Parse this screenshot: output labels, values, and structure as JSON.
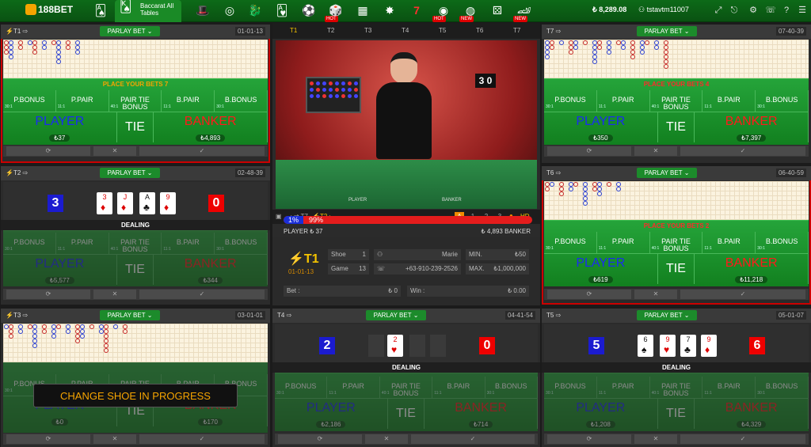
{
  "brand": {
    "logo": "188BET"
  },
  "nav": {
    "category": "Baccarat All Tables",
    "hot": "HOT",
    "new": "NEW"
  },
  "account": {
    "balance": "8,289.08",
    "user": "tstavtm11007"
  },
  "common": {
    "parlay": "PARLAY BET",
    "place": "PLACE YOUR BETS",
    "dealing": "DEALING",
    "side": {
      "pbonus": "P.BONUS",
      "ppair": "P.PAIR",
      "tiebonus": "PAIR TIE BONUS",
      "bpair": "B.PAIR",
      "bbonus": "B.BONUS"
    },
    "player": "PLAYER",
    "tie": "TIE",
    "banker": "BANKER",
    "odds": {
      "bonus": "30:1",
      "pair": "11:1",
      "tb": "40:1",
      "one": "1:1",
      "eight": "8:1",
      "banker": "0.95:1"
    }
  },
  "tables": {
    "t1": {
      "name": "T1",
      "code": "01-01-13",
      "countdown": "7",
      "player": "37",
      "banker": "4,893"
    },
    "t2": {
      "name": "T2",
      "code": "02-48-39",
      "pscore": "3",
      "bscore": "0",
      "player": "5,577",
      "banker": "344",
      "cards": [
        "3",
        "J",
        "A",
        "9"
      ]
    },
    "t3": {
      "name": "T3",
      "code": "03-01-01",
      "player": "0",
      "banker": "170",
      "message": "CHANGE SHOE IN PROGRESS"
    },
    "t4": {
      "name": "T4",
      "code": "04-41-54",
      "pscore": "2",
      "bscore": "0",
      "player": "2,186",
      "banker": "714",
      "cards": [
        "2"
      ]
    },
    "t5": {
      "name": "T5",
      "code": "05-01-07",
      "pscore": "5",
      "bscore": "6",
      "player": "1,208",
      "banker": "4,329",
      "cards": [
        "6",
        "9",
        "7",
        "9"
      ]
    },
    "t6": {
      "name": "T6",
      "code": "06-40-59",
      "countdown": "2",
      "player": "619",
      "banker": "11,218"
    },
    "t7": {
      "name": "T7",
      "code": "07-40-39",
      "countdown": "4",
      "player": "350",
      "banker": "7,397"
    }
  },
  "live": {
    "tabs": [
      "T1",
      "T2",
      "T3",
      "T4",
      "T5",
      "T6",
      "T7"
    ],
    "video_overlay": {
      "scoreboard": "3 0",
      "player_label": "PLAYER",
      "banker_label": "BANKER"
    },
    "prev": "T7",
    "next": "T2",
    "quality": [
      "A",
      "1",
      "2",
      "3"
    ],
    "hd": "HD",
    "player_pct": 1,
    "player_pct_label": "1%",
    "banker_pct_label": "99%",
    "player_total": "PLAYER  ₺ 37",
    "banker_total": "₺ 4,893 BANKER",
    "table": "T1",
    "code": "01-01-13",
    "shoe_label": "Shoe",
    "shoe": "1",
    "game_label": "Game",
    "game": "13",
    "dealer": "Marie",
    "phone": "+63-910-239-2526",
    "min_label": "MIN.",
    "min": "₺50",
    "max_label": "MAX.",
    "max": "₺1,000,000",
    "bet_label": "Bet :",
    "bet": "₺ 0",
    "win_label": "Win :",
    "win": "₺ 0.00"
  }
}
